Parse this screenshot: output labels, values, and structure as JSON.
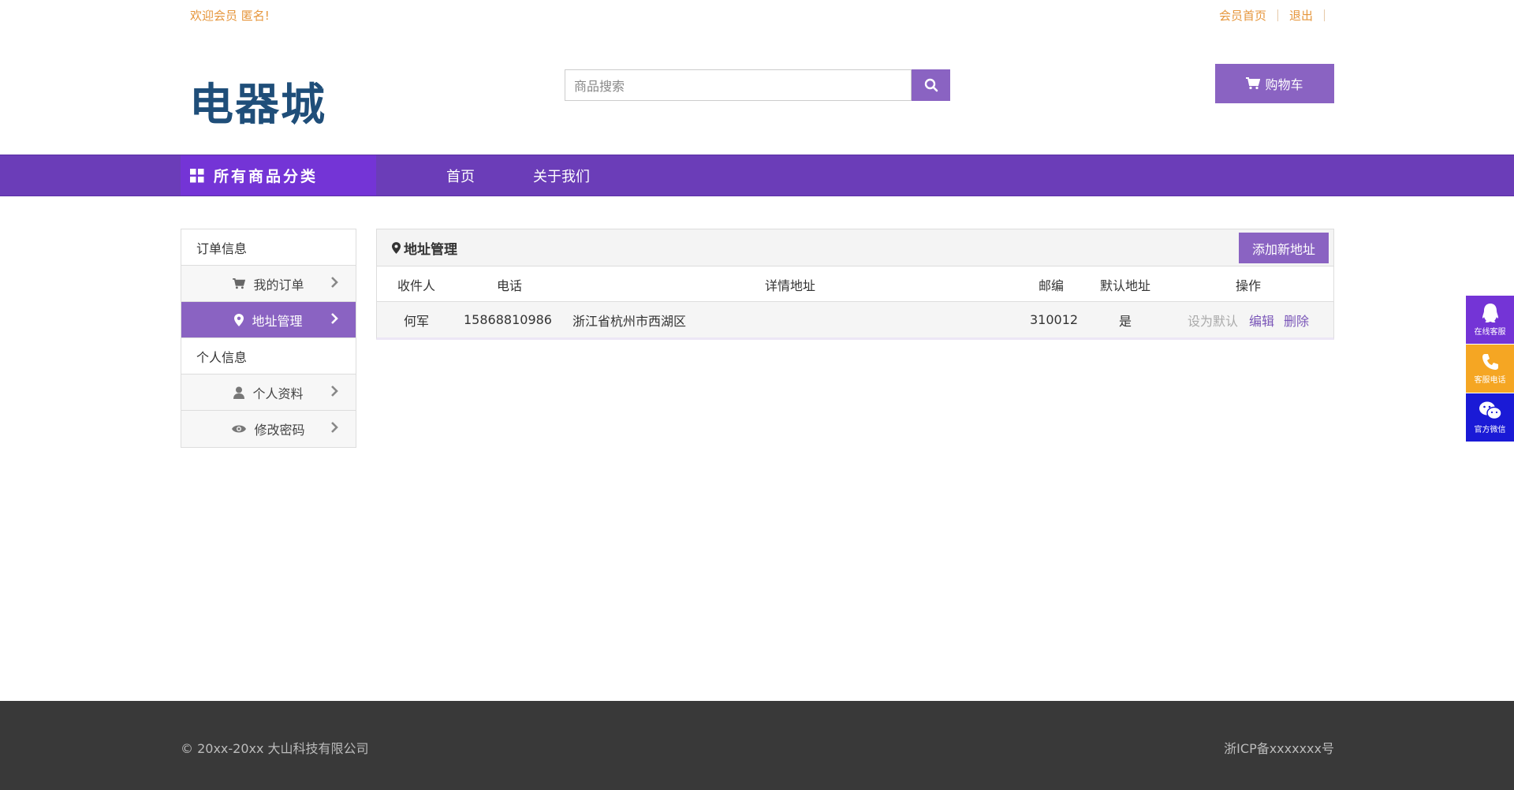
{
  "topbar": {
    "welcome": "欢迎会员 匿名!",
    "member_home": "会员首页",
    "logout": "退出"
  },
  "header": {
    "logo": "电器城",
    "search_placeholder": "商品搜索",
    "cart_label": "购物车"
  },
  "nav": {
    "all_categories": "所有商品分类",
    "items": [
      "首页",
      "关于我们"
    ]
  },
  "sidemenu": {
    "order_group": "订单信息",
    "my_orders": "我的订单",
    "address_mgmt": "地址管理",
    "personal_group": "个人信息",
    "profile": "个人资料",
    "change_password": "修改密码"
  },
  "panel": {
    "title": "地址管理",
    "add_button": "添加新地址",
    "columns": [
      "收件人",
      "电话",
      "详情地址",
      "邮编",
      "默认地址",
      "操作"
    ],
    "rows": [
      {
        "recipient": "何军",
        "phone": "15868810986",
        "address": "浙江省杭州市西湖区",
        "zip": "310012",
        "is_default": "是",
        "op_set_default": "设为默认",
        "op_edit": "编辑",
        "op_delete": "删除"
      }
    ]
  },
  "float_widget": {
    "qq": "在线客服",
    "phone": "客服电话",
    "wechat": "官方微信"
  },
  "footer": {
    "copyright": "© 20xx-20xx 大山科技有限公司",
    "icp": "浙ICP备xxxxxxx号"
  },
  "colors": {
    "brand_purple": "#8a63c2",
    "nav_purple": "#6b3db8",
    "accent_orange": "#e6963c",
    "footer_bg": "#393939"
  }
}
